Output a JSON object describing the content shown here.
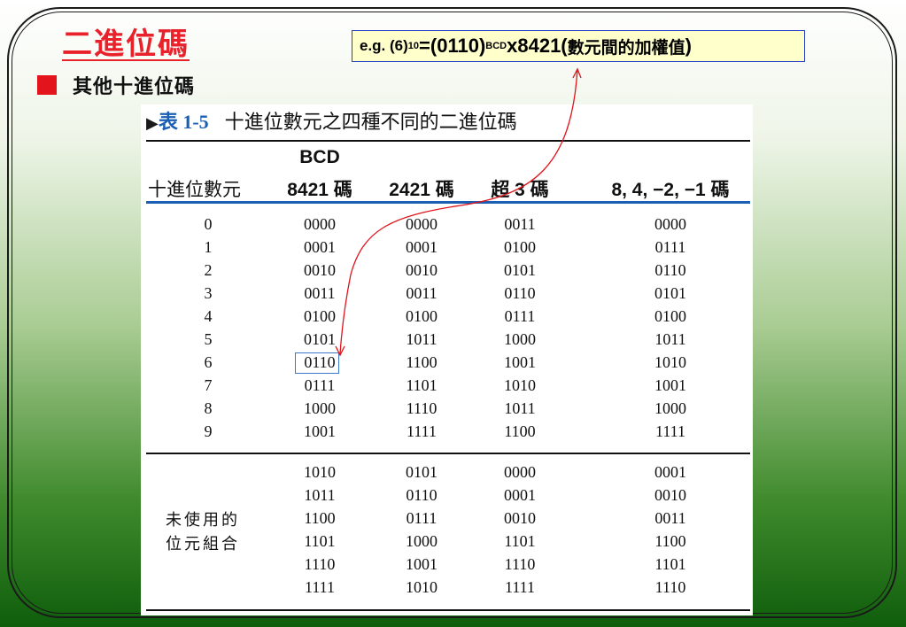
{
  "slide": {
    "title": "二進位碼",
    "bullet": "其他十進位碼",
    "example": {
      "part1": "e.g. (6)",
      "sub10": "10",
      "part2": "=(0110)",
      "subBCD": "BCD",
      "part3": "x8421(",
      "part4": "數元間的加權值",
      "part5": ")"
    }
  },
  "table": {
    "caption_marker": "▶",
    "caption_number": "表 1-5",
    "caption_text": "十進位數元之四種不同的二進位碼",
    "headers": {
      "col0": "十進位數元",
      "col1_top": "BCD",
      "col1": "8421 碼",
      "col2": "2421 碼",
      "col3": "超 3 碼",
      "col4": "8, 4, −2, −1 碼"
    },
    "rows": [
      [
        "0",
        "0000",
        "0000",
        "0011",
        "0000"
      ],
      [
        "1",
        "0001",
        "0001",
        "0100",
        "0111"
      ],
      [
        "2",
        "0010",
        "0010",
        "0101",
        "0110"
      ],
      [
        "3",
        "0011",
        "0011",
        "0110",
        "0101"
      ],
      [
        "4",
        "0100",
        "0100",
        "0111",
        "0100"
      ],
      [
        "5",
        "0101",
        "1011",
        "1000",
        "1011"
      ],
      [
        "6",
        "0110",
        "1100",
        "1001",
        "1010"
      ],
      [
        "7",
        "0111",
        "1101",
        "1010",
        "1001"
      ],
      [
        "8",
        "1000",
        "1110",
        "1011",
        "1000"
      ],
      [
        "9",
        "1001",
        "1111",
        "1100",
        "1111"
      ]
    ],
    "unused_label_line1": "未使用的",
    "unused_label_line2": "位元組合",
    "unused_rows": [
      [
        "1010",
        "0101",
        "0000",
        "0001"
      ],
      [
        "1011",
        "0110",
        "0001",
        "0010"
      ],
      [
        "1100",
        "0111",
        "0010",
        "0011"
      ],
      [
        "1101",
        "1000",
        "1101",
        "1100"
      ],
      [
        "1110",
        "1001",
        "1110",
        "1101"
      ],
      [
        "1111",
        "1010",
        "1111",
        "1110"
      ]
    ],
    "highlight": {
      "row": 6,
      "col": 1
    }
  },
  "colors": {
    "title": "#e8212b",
    "bullet": "#e4141c",
    "example_bg": "#ffffcc",
    "example_border": "#2b3fc4",
    "arrow": "#e0141c",
    "caption_number": "#1b5fb4",
    "header_rule": "#1b5fb4",
    "highlight_box": "#3a79c9"
  }
}
